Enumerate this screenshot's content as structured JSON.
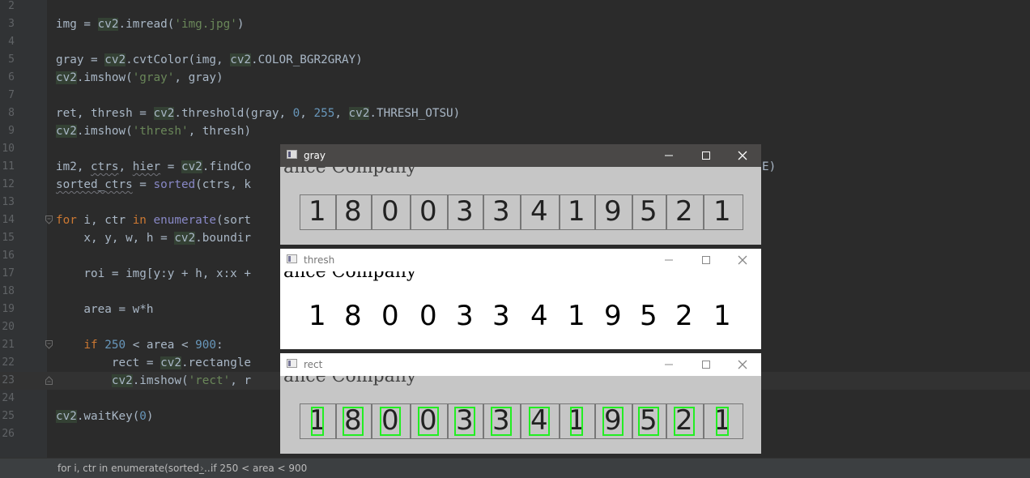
{
  "editor": {
    "line_numbers": [
      "2",
      "3",
      "4",
      "5",
      "6",
      "7",
      "8",
      "9",
      "10",
      "11",
      "12",
      "13",
      "14",
      "15",
      "16",
      "17",
      "18",
      "19",
      "20",
      "21",
      "22",
      "23",
      "24",
      "25",
      "26"
    ],
    "lines": {
      "l3": {
        "a": "img = ",
        "b": "cv2",
        "c": ".imread(",
        "d": "'img.jpg'",
        "e": ")"
      },
      "l5": {
        "a": "gray = ",
        "b": "cv2",
        "c": ".cvtColor(img, ",
        "d": "cv2",
        "e": ".COLOR_BGR2GRAY)"
      },
      "l6": {
        "a": "cv2",
        "b": ".imshow(",
        "c": "'gray'",
        "d": ", gray)"
      },
      "l8": {
        "a": "ret, thresh = ",
        "b": "cv2",
        "c": ".threshold(gray, ",
        "d": "0",
        "e": ", ",
        "f": "255",
        "g": ", ",
        "h": "cv2",
        "i": ".THRESH_OTSU)"
      },
      "l9": {
        "a": "cv2",
        "b": ".imshow(",
        "c": "'thresh'",
        "d": ", thresh)"
      },
      "l11": {
        "a": "im2, ",
        "b": "ctrs",
        "c": ", ",
        "d": "hier",
        "e": " = ",
        "f": "cv2",
        "g": ".findCo",
        "h": "E)"
      },
      "l12": {
        "a": "sorted_ctrs",
        "b": " = ",
        "c": "sorted",
        "d": "(ctrs, k"
      },
      "l14": {
        "a": "for",
        "b": " i, ctr ",
        "c": "in",
        "d": " ",
        "e": "enumerate",
        "f": "(sort"
      },
      "l15": {
        "a": "    x, y, w, h = ",
        "b": "cv2",
        "c": ".boundir"
      },
      "l17": {
        "a": "    roi = img[y:y + h, x:x +"
      },
      "l19": {
        "a": "    area = w*h"
      },
      "l21": {
        "a": "    ",
        "b": "if",
        "c": " ",
        "d": "250",
        "e": " < area < ",
        "f": "900",
        "g": ":"
      },
      "l22": {
        "a": "        rect = ",
        "b": "cv2",
        "c": ".rectangle"
      },
      "l23": {
        "a": "        ",
        "b": "cv2",
        "c": ".imshow(",
        "d": "'rect'",
        "e": ", r"
      },
      "l25": {
        "a": "cv2",
        "b": ".waitKey(",
        "c": "0",
        "d": ")"
      }
    }
  },
  "statusbar": {
    "crumb1": "for i, ctr in enumerate(sorted_...",
    "crumb2": "if 250 < area < 900"
  },
  "windows": [
    {
      "title": "gray",
      "icon": "opencv-window-icon"
    },
    {
      "title": "thresh",
      "icon": "opencv-window-icon"
    },
    {
      "title": "rect",
      "icon": "opencv-window-icon"
    }
  ],
  "image": {
    "header_text": "ance Company",
    "digits": [
      "1",
      "8",
      "0",
      "0",
      "3",
      "3",
      "4",
      "1",
      "9",
      "5",
      "2",
      "1"
    ]
  },
  "colors": {
    "editor_bg": "#2b2b2b",
    "keyword": "#cc7832",
    "string": "#6a8759",
    "number": "#6897bb",
    "box_green": "#22ee22"
  }
}
